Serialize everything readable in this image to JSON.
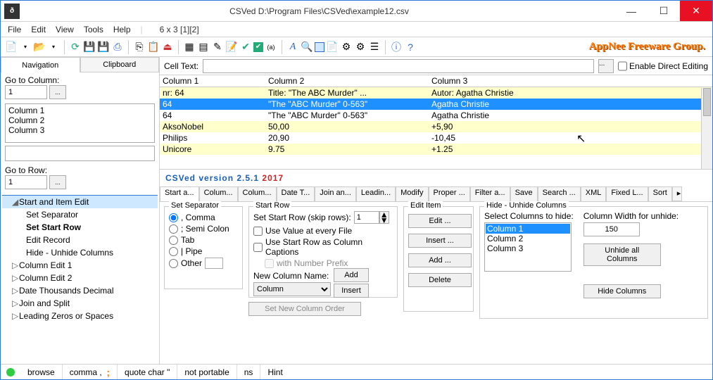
{
  "titlebar": {
    "title": "CSVed D:\\Program Files\\CSVed\\example12.csv"
  },
  "menubar": {
    "file": "File",
    "edit": "Edit",
    "view": "View",
    "tools": "Tools",
    "help": "Help",
    "status": "6 x 3 [1][2]"
  },
  "brand": "AppNee Freeware Group.",
  "leftpane": {
    "tabs": {
      "nav": "Navigation",
      "clip": "Clipboard"
    },
    "gotoCol": {
      "label": "Go to Column:",
      "value": "1"
    },
    "columns": [
      "Column 1",
      "Column 2",
      "Column 3"
    ],
    "gotoRow": {
      "label": "Go to Row:",
      "value": "1"
    },
    "tree": {
      "root": "Start and Item Edit",
      "children": [
        "Set Separator",
        "Set Start Row",
        "Edit Record",
        "Hide - Unhide Columns"
      ],
      "rest": [
        "Column Edit 1",
        "Column Edit 2",
        "Date Thousands Decimal",
        "Join and Split",
        "Leading Zeros or Spaces"
      ]
    }
  },
  "celltext": {
    "label": "Cell Text:",
    "value": "",
    "chk": "Enable Direct Editing"
  },
  "grid": {
    "headers": [
      "Column 1",
      "Column 2",
      "Column 3"
    ],
    "rows": [
      {
        "c": [
          "nr: 64",
          "Title: \"The ABC Murder\" ...",
          "Autor: Agatha Christie"
        ],
        "cls": "yel"
      },
      {
        "c": [
          "64",
          "\"The \"ABC Murder\" 0-563\"",
          "Agatha Christie"
        ],
        "cls": "sel"
      },
      {
        "c": [
          "64",
          "\"The \"ABC Murder\" 0-563\"",
          "Agatha Christie"
        ],
        "cls": ""
      },
      {
        "c": [
          "AksoNobel",
          "50,00",
          "+5,90"
        ],
        "cls": "yel"
      },
      {
        "c": [
          "Philips",
          "20,90",
          "-10,45"
        ],
        "cls": ""
      },
      {
        "c": [
          "Unicore",
          "9.75",
          "+1.25"
        ],
        "cls": "yel"
      }
    ]
  },
  "version": {
    "a": "CSVed version 2.5.1 ",
    "b": "2017"
  },
  "btabs": [
    "Start a...",
    "Colum...",
    "Colum...",
    "Date T...",
    "Join an...",
    "Leadin...",
    "Modify",
    "Proper ...",
    "Filter a...",
    "Save",
    "Search ...",
    "XML",
    "Fixed L...",
    "Sort"
  ],
  "sep": {
    "legend": "Set Separator",
    "opts": [
      ", Comma",
      "; Semi Colon",
      "Tab",
      "| Pipe",
      "Other"
    ]
  },
  "startrow": {
    "legend": "Start Row",
    "label": "Set Start Row (skip rows):",
    "value": "1",
    "c1": "Use Value at every File",
    "c2": "Use Start Row as Column Captions",
    "c3": "with Number Prefix",
    "newcol": "New Column Name:",
    "newcolval": "Column",
    "add": "Add",
    "insert": "Insert",
    "order": "Set New Column Order"
  },
  "edititem": {
    "legend": "Edit Item",
    "edit": "Edit ...",
    "insert": "Insert ...",
    "add": "Add ...",
    "delete": "Delete"
  },
  "hideunhide": {
    "legend": "Hide - Unhide Columns",
    "sel": "Select Columns to hide:",
    "items": [
      "Column 1",
      "Column 2",
      "Column 3"
    ],
    "colw": "Column Width for unhide:",
    "colwval": "150",
    "unhide": "Unhide all Columns",
    "hide": "Hide Columns"
  },
  "status": {
    "browse": "browse",
    "comma": "comma ,",
    "quote": "quote char \"",
    "portable": "not portable",
    "ns": "ns",
    "hint": "Hint"
  }
}
